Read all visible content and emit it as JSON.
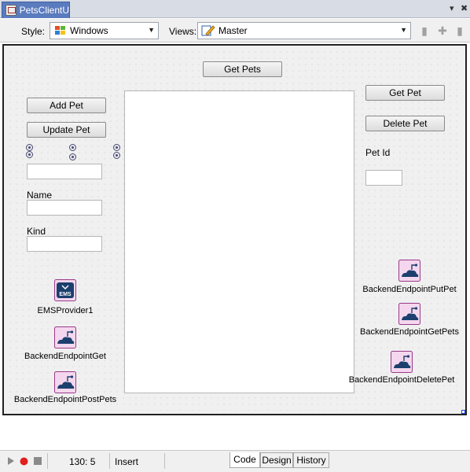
{
  "window": {
    "tab_title": "PetsClientU",
    "menu_glyph": "▾",
    "close_glyph": "✖"
  },
  "toolbar": {
    "style_label": "Style:",
    "style_value": "Windows",
    "views_label": "Views:",
    "views_value": "Master"
  },
  "form": {
    "get_pets_button": "Get Pets",
    "add_pet_button": "Add Pet",
    "update_pet_button": "Update Pet",
    "get_pet_button": "Get Pet",
    "delete_pet_button": "Delete Pet",
    "pet_id_label": "Pet Id",
    "name_label": "Name",
    "kind_label": "Kind"
  },
  "components": [
    {
      "label": "EMSProvider1",
      "icon": "ems-provider-icon"
    },
    {
      "label": "BackendEndpointGet",
      "icon": "backend-endpoint-icon"
    },
    {
      "label": "BackendEndpointPostPets",
      "icon": "backend-endpoint-icon"
    },
    {
      "label": "BackendEndpointPutPet",
      "icon": "backend-endpoint-icon"
    },
    {
      "label": "BackendEndpointGetPets",
      "icon": "backend-endpoint-icon"
    },
    {
      "label": "BackendEndpointDeletePet",
      "icon": "backend-endpoint-icon"
    }
  ],
  "ems_icon_text": "EMS",
  "statusbar": {
    "position": "130:  5",
    "mode": "Insert",
    "tabs": [
      "Code",
      "Design",
      "History"
    ],
    "active_tab": "Code"
  }
}
